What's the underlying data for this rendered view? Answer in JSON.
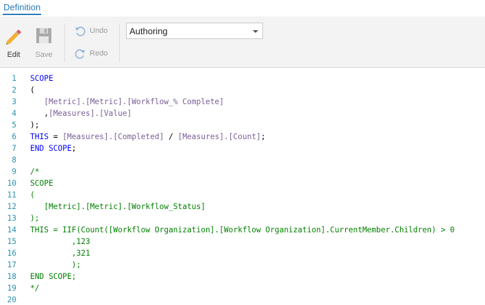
{
  "tabs": [
    {
      "label": "Definition",
      "active": true
    }
  ],
  "toolbar": {
    "edit": {
      "label": "Edit",
      "icon": "pencil-icon"
    },
    "save": {
      "label": "Save",
      "icon": "floppy-disk-icon",
      "enabled": false
    },
    "undo": {
      "label": "Undo",
      "icon": "undo-arrow-icon",
      "enabled": false
    },
    "redo": {
      "label": "Redo",
      "icon": "redo-arrow-icon",
      "enabled": false
    },
    "mode_select": {
      "value": "Authoring"
    }
  },
  "colors": {
    "accent": "#2a7ab8",
    "line_number": "#2b91af",
    "keyword": "#0000ff",
    "member": "#795e98",
    "comment": "#008000"
  },
  "editor": {
    "lines": [
      {
        "n": "1",
        "tokens": [
          {
            "t": "SCOPE",
            "c": "kw"
          }
        ]
      },
      {
        "n": "2",
        "tokens": [
          {
            "t": "(",
            "c": "df"
          }
        ]
      },
      {
        "n": "3",
        "tokens": [
          {
            "t": "   ",
            "c": "df"
          },
          {
            "t": "[Metric].[Metric].[Workflow_% Complete]",
            "c": "mb"
          }
        ]
      },
      {
        "n": "4",
        "tokens": [
          {
            "t": "   ,",
            "c": "df"
          },
          {
            "t": "[Measures].[Value]",
            "c": "mb"
          }
        ]
      },
      {
        "n": "5",
        "tokens": [
          {
            "t": ");",
            "c": "df"
          }
        ]
      },
      {
        "n": "6",
        "tokens": [
          {
            "t": "THIS",
            "c": "kw"
          },
          {
            "t": " = ",
            "c": "df"
          },
          {
            "t": "[Measures].[Completed]",
            "c": "mb"
          },
          {
            "t": " / ",
            "c": "df"
          },
          {
            "t": "[Measures].[Count]",
            "c": "mb"
          },
          {
            "t": ";",
            "c": "df"
          }
        ]
      },
      {
        "n": "7",
        "tokens": [
          {
            "t": "END SCOPE",
            "c": "kw"
          },
          {
            "t": ";",
            "c": "df"
          }
        ]
      },
      {
        "n": "8",
        "tokens": []
      },
      {
        "n": "9",
        "tokens": [
          {
            "t": "/*",
            "c": "cm"
          }
        ]
      },
      {
        "n": "10",
        "tokens": [
          {
            "t": "SCOPE",
            "c": "cm"
          }
        ]
      },
      {
        "n": "11",
        "tokens": [
          {
            "t": "(",
            "c": "cm"
          }
        ]
      },
      {
        "n": "12",
        "tokens": [
          {
            "t": "   [Metric].[Metric].[Workflow_Status]",
            "c": "cm"
          }
        ]
      },
      {
        "n": "13",
        "tokens": [
          {
            "t": ");",
            "c": "cm"
          }
        ]
      },
      {
        "n": "14",
        "tokens": [
          {
            "t": "THIS = IIF(Count([Workflow Organization].[Workflow Organization].CurrentMember.Children) > 0",
            "c": "cm"
          }
        ]
      },
      {
        "n": "15",
        "tokens": [
          {
            "t": "         ,123",
            "c": "cm"
          }
        ]
      },
      {
        "n": "16",
        "tokens": [
          {
            "t": "         ,321",
            "c": "cm"
          }
        ]
      },
      {
        "n": "17",
        "tokens": [
          {
            "t": "         );",
            "c": "cm"
          }
        ]
      },
      {
        "n": "18",
        "tokens": [
          {
            "t": "END SCOPE;",
            "c": "cm"
          }
        ]
      },
      {
        "n": "19",
        "tokens": [
          {
            "t": "*/",
            "c": "cm"
          }
        ]
      },
      {
        "n": "20",
        "tokens": []
      }
    ]
  }
}
